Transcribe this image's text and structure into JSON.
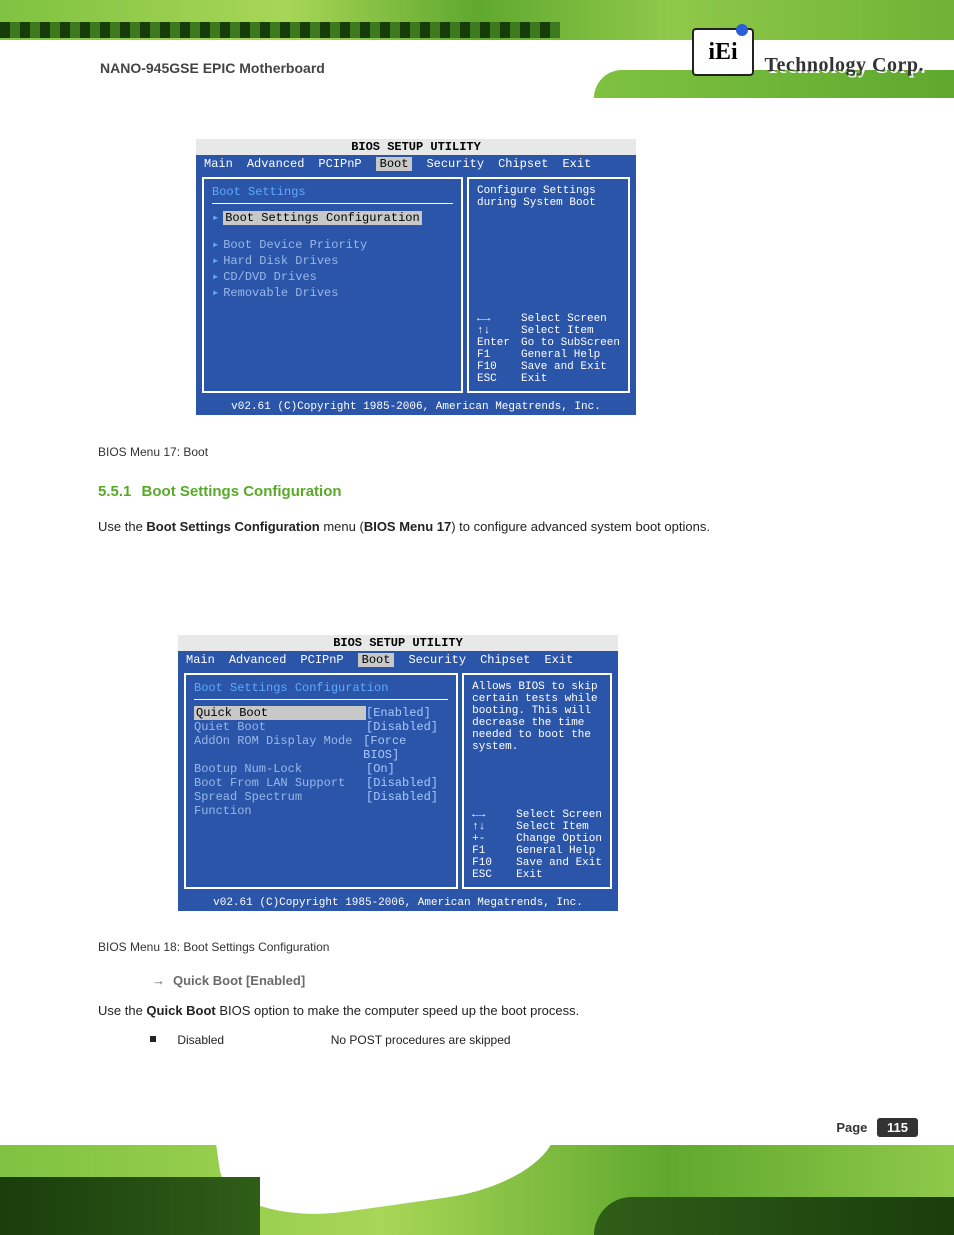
{
  "header": {
    "logo_text": "iEi",
    "brand": "Technology Corp.",
    "doc_title": "NANO-945GSE EPIC Motherboard"
  },
  "bios_common": {
    "title": "BIOS SETUP UTILITY",
    "tabs": [
      "Main",
      "Advanced",
      "PCIPnP",
      "Boot",
      "Security",
      "Chipset",
      "Exit"
    ],
    "selected_tab": "Boot",
    "footer": "v02.61 (C)Copyright 1985-2006, American Megatrends, Inc."
  },
  "bios1": {
    "heading": "Boot Settings",
    "items": [
      "Boot Settings Configuration",
      "Boot Device Priority",
      "Hard Disk Drives",
      "CD/DVD Drives",
      "Removable Drives"
    ],
    "help_top": "Configure Settings during System Boot",
    "keys": [
      {
        "key": "←→",
        "desc": "Select Screen"
      },
      {
        "key": "↑↓",
        "desc": "Select Item"
      },
      {
        "key": "Enter",
        "desc": "Go to SubScreen"
      },
      {
        "key": "F1",
        "desc": "General Help"
      },
      {
        "key": "F10",
        "desc": "Save and Exit"
      },
      {
        "key": "ESC",
        "desc": "Exit"
      }
    ]
  },
  "caption1": {
    "label": "BIOS Menu 17: Boot"
  },
  "section1": {
    "number": "5.5.1",
    "title": "Boot Settings Configuration",
    "para": "Use the Boot Settings Configuration menu (BIOS Menu 17) to configure advanced system boot options."
  },
  "bios2": {
    "heading": "Boot Settings Configuration",
    "rows": [
      {
        "label": "Quick Boot",
        "value": "[Enabled]"
      },
      {
        "label": "Quiet Boot",
        "value": "[Disabled]"
      },
      {
        "label": "AddOn ROM Display Mode",
        "value": "[Force BIOS]"
      },
      {
        "label": "Bootup Num-Lock",
        "value": "[On]"
      },
      {
        "label": "Boot From LAN Support",
        "value": "[Disabled]"
      },
      {
        "label": "Spread Spectrum Function",
        "value": "[Disabled]"
      }
    ],
    "help_top": "Allows BIOS to skip certain tests while booting. This will decrease the time needed to boot the system.",
    "keys": [
      {
        "key": "←→",
        "desc": "Select Screen"
      },
      {
        "key": "↑↓",
        "desc": "Select Item"
      },
      {
        "key": "+-",
        "desc": "Change Option"
      },
      {
        "key": "F1",
        "desc": "General Help"
      },
      {
        "key": "F10",
        "desc": "Save and Exit"
      },
      {
        "key": "ESC",
        "desc": "Exit"
      }
    ]
  },
  "caption2": {
    "label": "BIOS Menu 18: Boot Settings Configuration"
  },
  "option1": {
    "head": "Quick Boot [Enabled]",
    "desc": "Use the Quick Boot BIOS option to make the computer speed up the boot process.",
    "bullet_label": "Disabled",
    "bullet_desc": "No POST procedures are skipped"
  },
  "page": {
    "label": "Page",
    "num": "115"
  }
}
